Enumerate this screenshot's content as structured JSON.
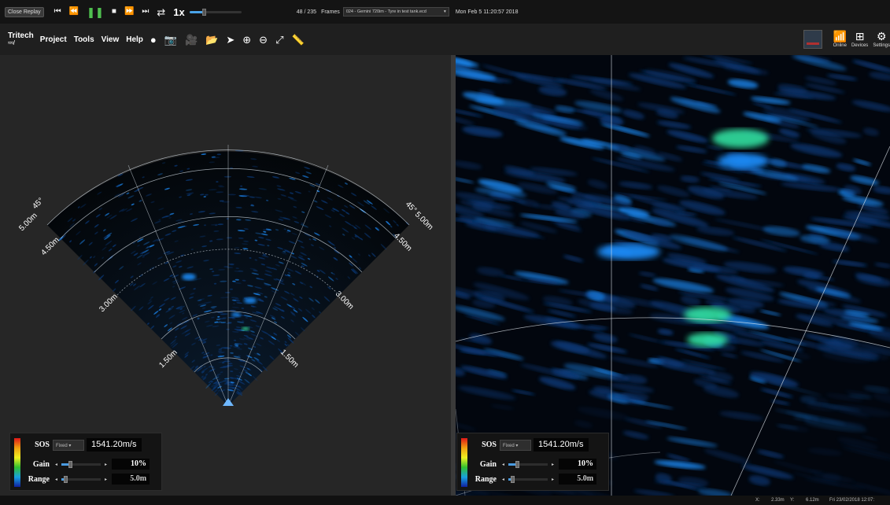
{
  "replay": {
    "close_label": "Close Replay",
    "speed": "1x",
    "speed_position": 0.28,
    "frame_current": 48,
    "frame_total": 235,
    "frame_text": "48 / 235",
    "frames_label": "Frames",
    "file": "024 - Gemini 720im - Tyre in test tank.ecd",
    "timestamp": "Mon Feb 5 11:20:57 2018"
  },
  "menu": {
    "logo_text": "Tritech",
    "logo_wave": "≈≈/",
    "items": [
      "Project",
      "Tools",
      "View",
      "Help"
    ]
  },
  "right_tools": {
    "online_label": "Online",
    "devices_label": "Devices",
    "settings_label": "Settings"
  },
  "sonar": {
    "angle_left": "45°",
    "angle_right": "45°",
    "range_labels": {
      "r500_left": "5.00m",
      "r500_right": "5.00m",
      "r450_left": "4.50m",
      "r450_right": "4.50m",
      "r300_left": "3.00m",
      "r300_right": "3.00m",
      "r150_left": "1.50m",
      "r150_right": "1.50m"
    }
  },
  "controls": {
    "sos_label": "SOS",
    "sos_mode": "Fixed",
    "sos_value": "1541.20m/s",
    "gain_label": "Gain",
    "gain_value": "10%",
    "gain_level": 0.1,
    "range_label": "Range",
    "range_value": "5.0m",
    "range_level": 0.05
  },
  "status": {
    "x_label": "X:",
    "x_value": "2.33m",
    "y_label": "Y:",
    "y_value": "6.12m",
    "datetime": "Fri 23/02/2018 12:07:"
  },
  "colors": {
    "sonar_low": "#0a3a7a",
    "sonar_mid": "#1e90ff",
    "sonar_high": "#30e0a0",
    "accent": "#4aa3e8"
  }
}
